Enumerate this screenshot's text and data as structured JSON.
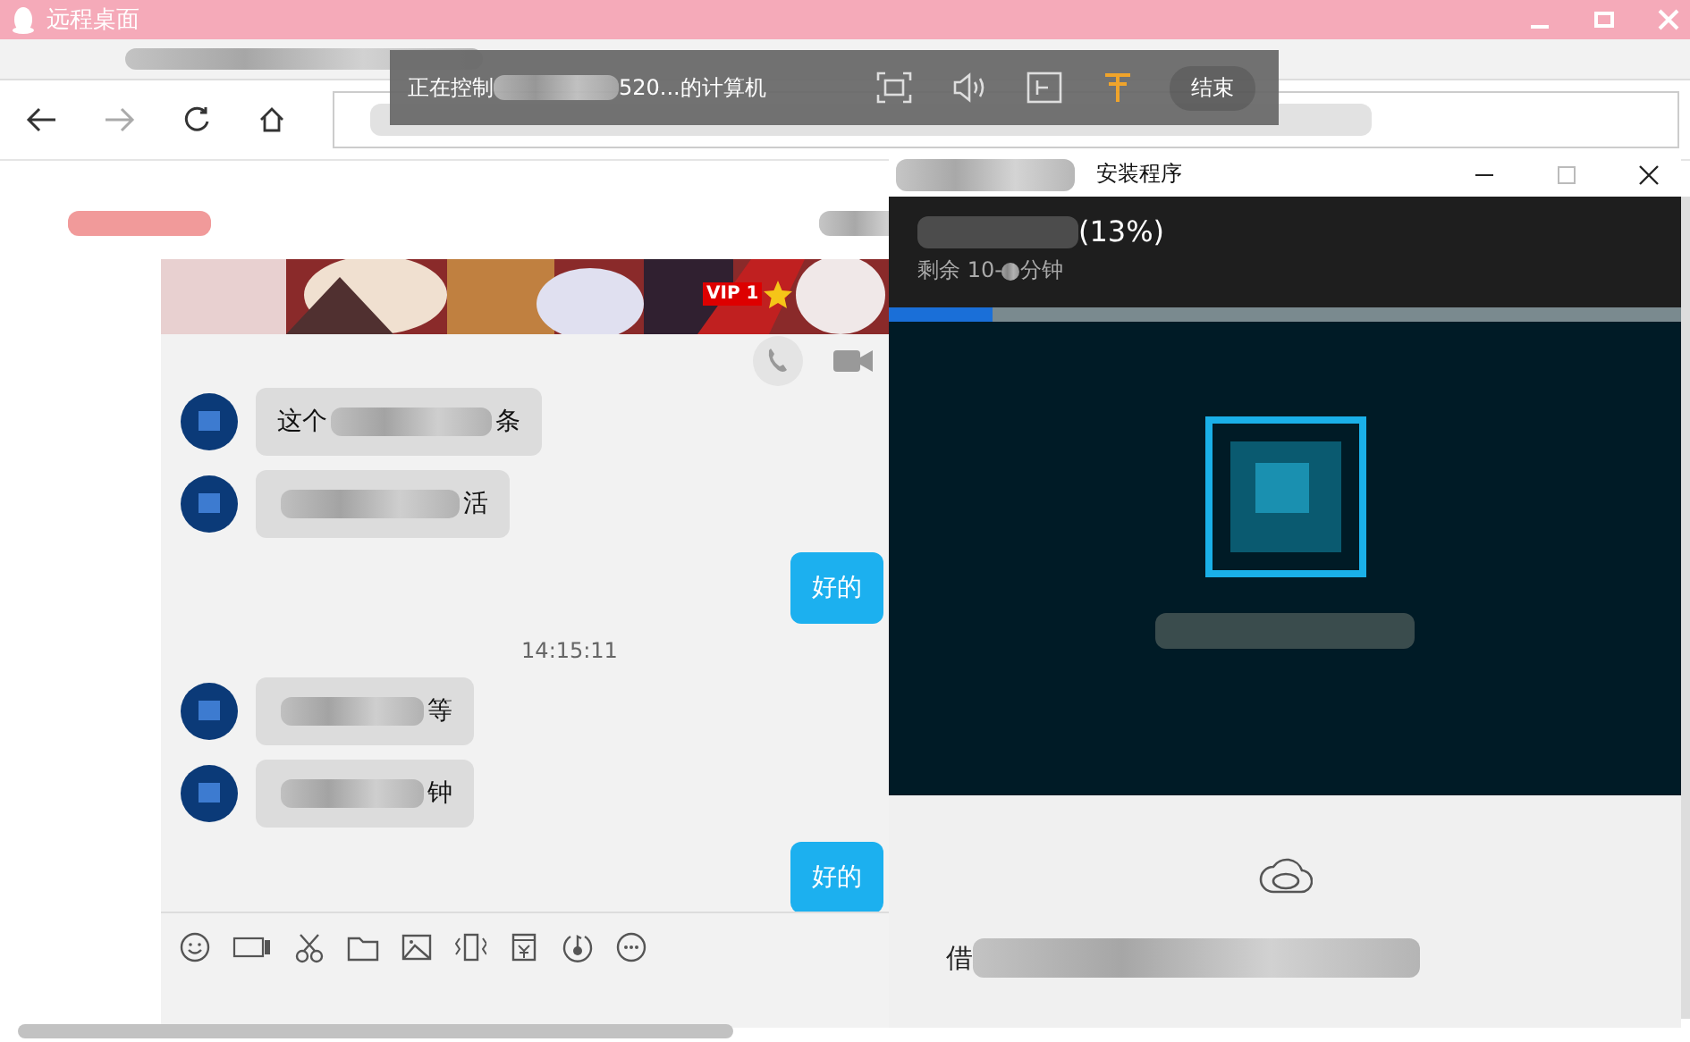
{
  "window": {
    "title": "远程桌面"
  },
  "remote_bar": {
    "status_start": "正在控制",
    "status_end": "520...的计算机",
    "end_button": "结束"
  },
  "chat": {
    "banner": {
      "badge": "VIP 1"
    },
    "messages": [
      {
        "kind": "incoming",
        "start": "这个",
        "end": "条"
      },
      {
        "kind": "incoming",
        "end": "活"
      },
      {
        "kind": "outgoing",
        "text": "好的"
      },
      {
        "kind": "time",
        "text": "14:15:11"
      },
      {
        "kind": "incoming",
        "end": "等"
      },
      {
        "kind": "incoming",
        "end": "钟"
      },
      {
        "kind": "outgoing",
        "text": "好的"
      }
    ]
  },
  "installer": {
    "title": "安装程序",
    "percent": "(13%)",
    "remaining_start": "剩余 10-",
    "remaining_end": "分钟",
    "progress": {
      "level": 0.13
    },
    "footer_start": "借"
  }
}
